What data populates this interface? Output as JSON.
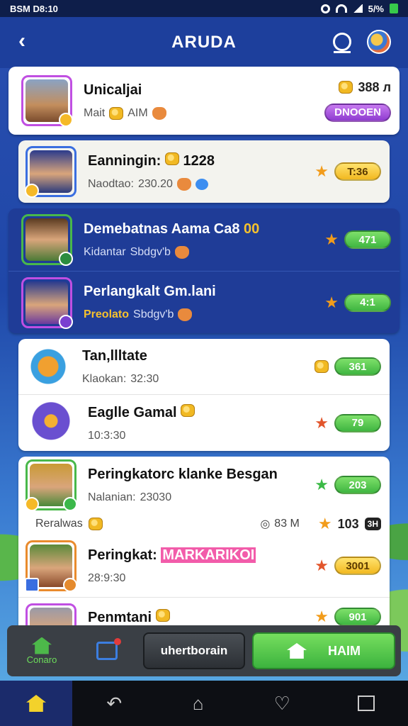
{
  "status_bar": {
    "time": "BSM D8:10",
    "battery": "5/%"
  },
  "header": {
    "title": "ARUDA"
  },
  "cards": [
    {
      "name": "Unicaljai",
      "sub_prefix": "Mait",
      "sub_value": "AIM",
      "coin_value": "388 л",
      "badge": "DNOOEN"
    },
    {
      "name": "Eanningin:",
      "name_value": "1228",
      "sub_prefix": "Naodtao:",
      "sub_value": "230.20",
      "badge": "T:36"
    },
    {
      "name": "Demebatnas Aama Ca8",
      "name_suffix": "00",
      "sub_prefix": "Kidantar",
      "sub_value": "Sbdgv'b",
      "badge": "471"
    },
    {
      "name": "Perlangkalt Gm.lani",
      "sub_prefix": "Preolato",
      "sub_value": "Sbdgv'b",
      "badge": "4:1"
    },
    {
      "name": "Tan,llltate",
      "sub_prefix": "Klaokan:",
      "sub_value": "32:30",
      "badge": "361"
    },
    {
      "name": "Eaglle Gamal",
      "sub_value": "10:3:30",
      "badge": "79"
    },
    {
      "name": "Peringkatorc klanke Besgan",
      "sub_prefix": "Nalanian:",
      "sub_value": "23030",
      "badge": "203"
    },
    {
      "name_extra": "Reralwas",
      "clock_value": "83 M",
      "coin_value": "103",
      "chip": "3H"
    },
    {
      "name": "Peringkat:",
      "name_highlight": "MARKARIKOI",
      "sub_value": "28:9:30",
      "badge": "3001"
    },
    {
      "name": "Penmtani",
      "badge": "901"
    }
  ],
  "action_bar": {
    "home_label": "Conaro",
    "dark_button": "uhertborain",
    "green_button": "HAIM"
  },
  "colors": {
    "primary_blue": "#1d3f9c",
    "accent_green": "#3fb641",
    "accent_yellow": "#f2b820",
    "accent_purple": "#8e3bd0"
  }
}
